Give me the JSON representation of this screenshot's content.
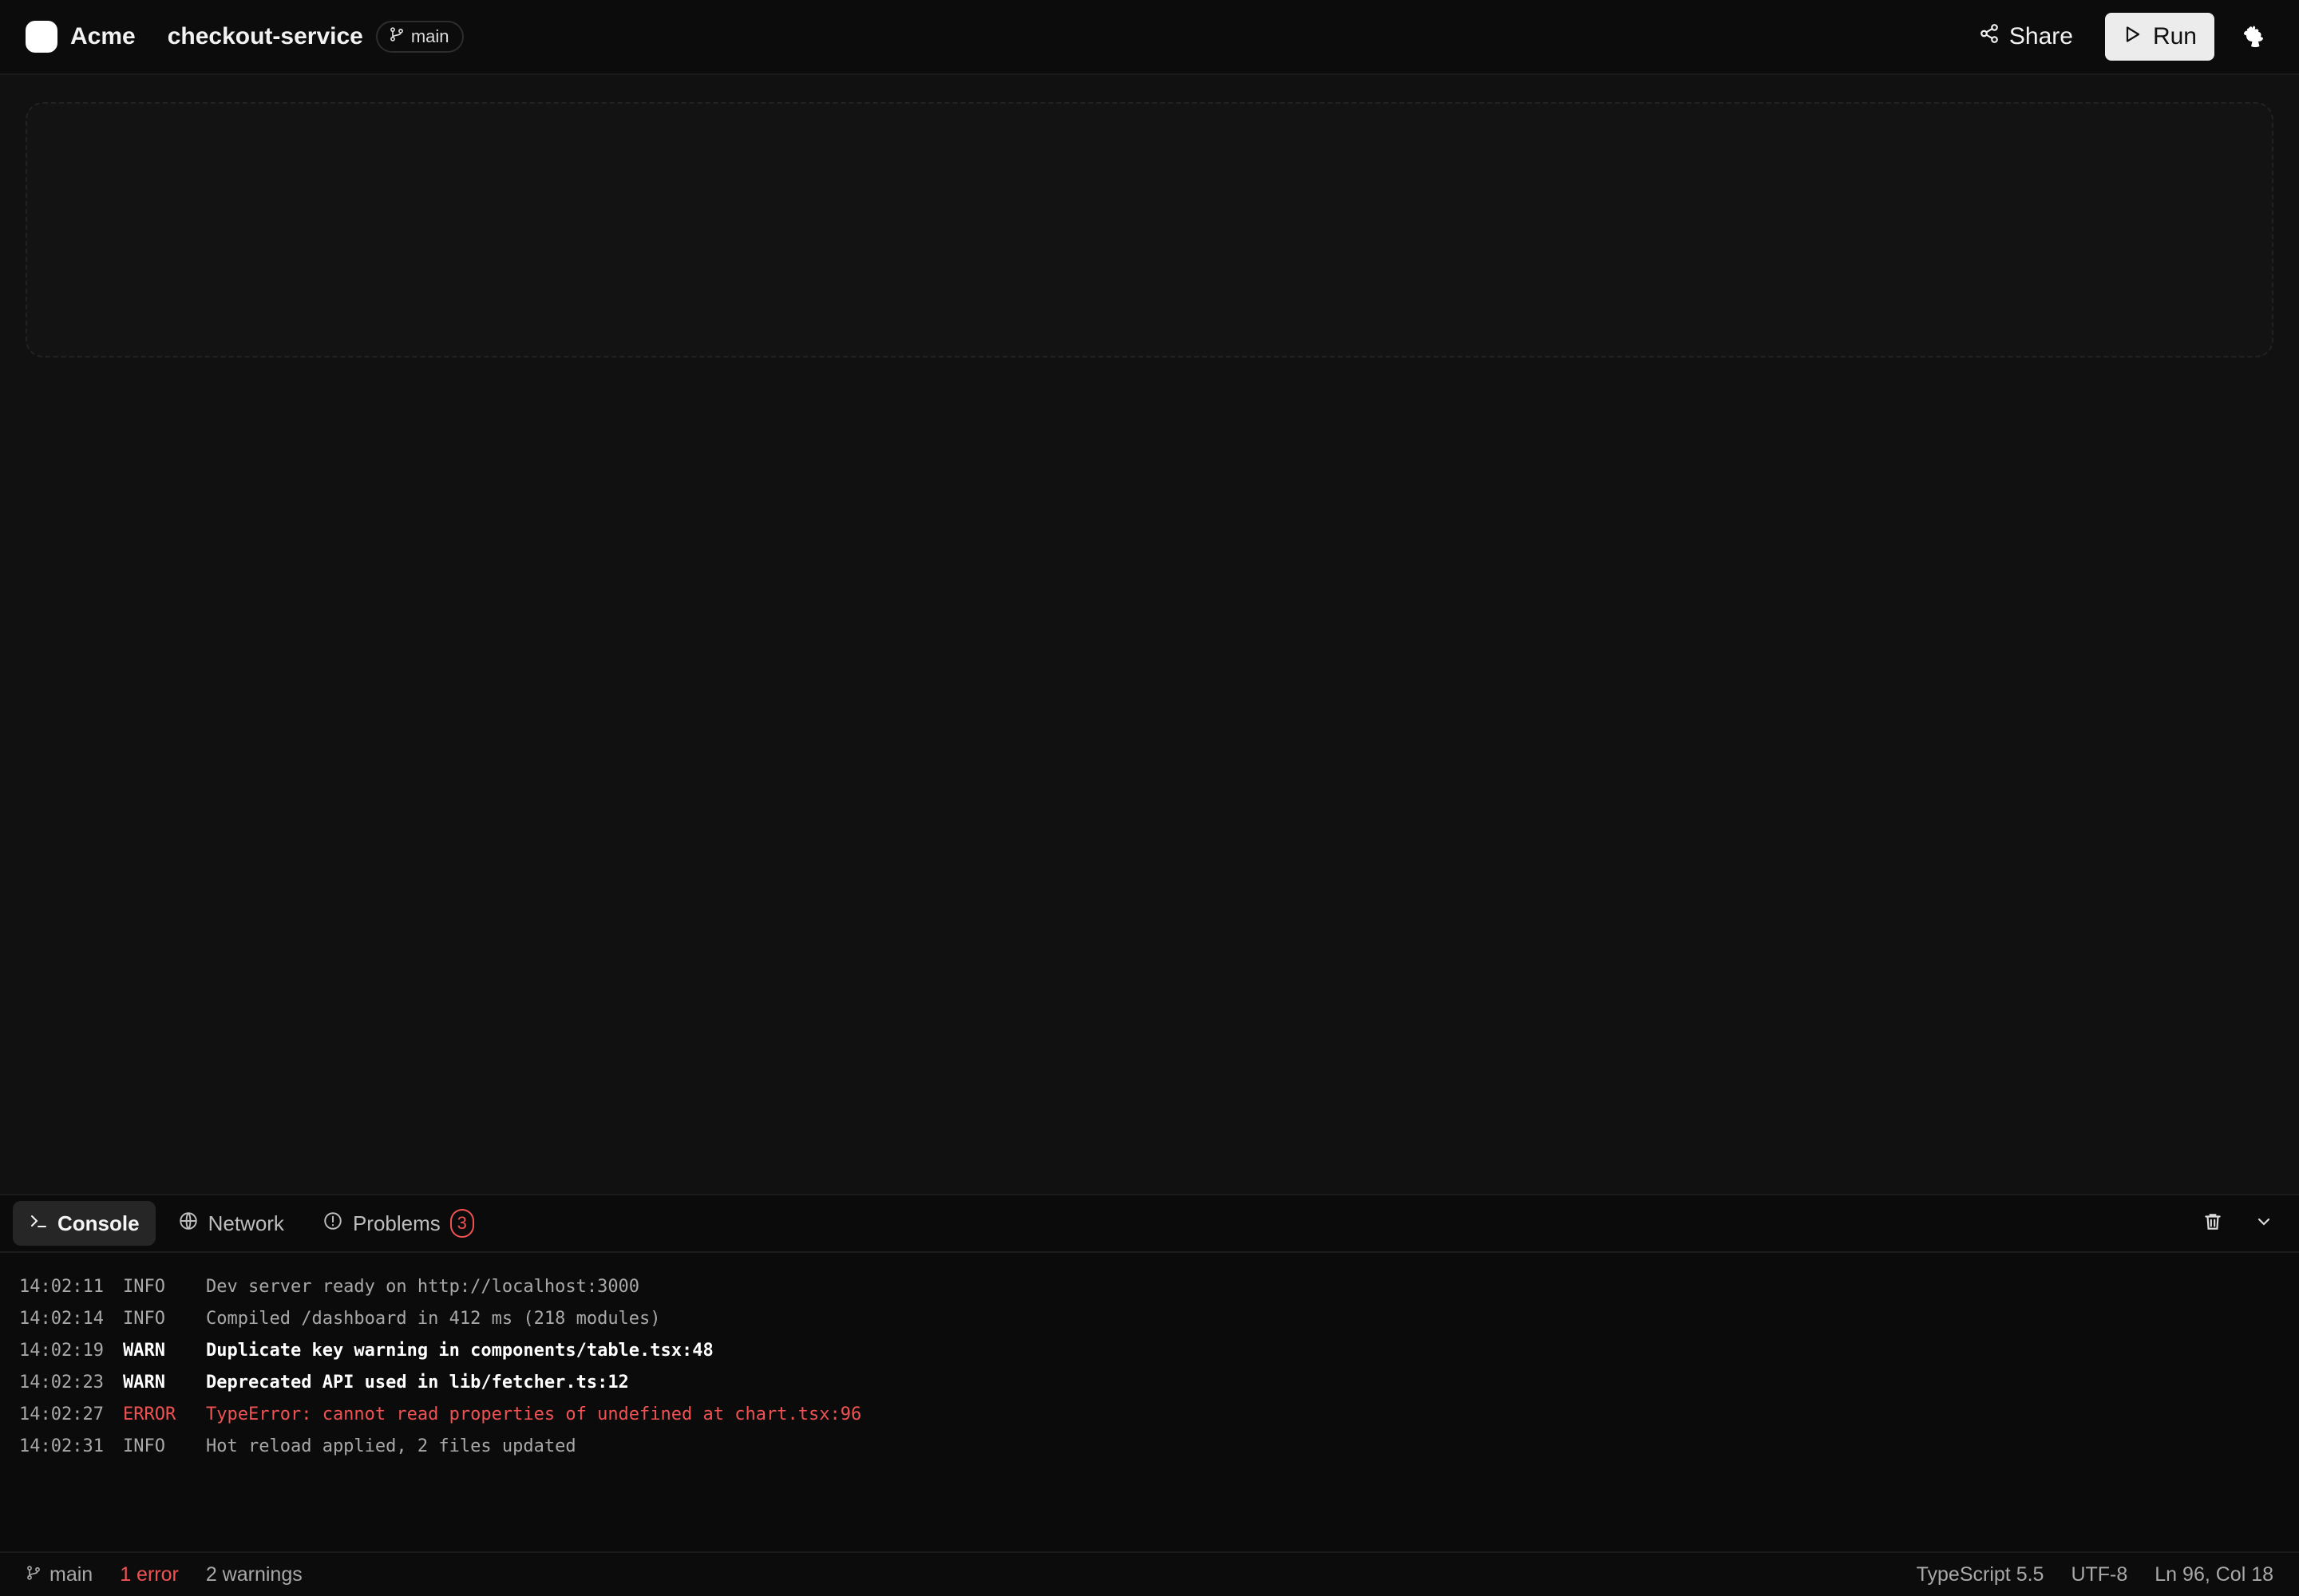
{
  "header": {
    "brand": "Acme",
    "project": "checkout-service",
    "branch": "main",
    "share_label": "Share",
    "run_label": "Run"
  },
  "panel": {
    "tabs": [
      {
        "label": "Console",
        "icon": "terminal-icon"
      },
      {
        "label": "Network",
        "icon": "globe-icon"
      },
      {
        "label": "Problems",
        "icon": "alert-circle-icon",
        "badge": "3"
      }
    ],
    "logs": [
      {
        "time": "14:02:11",
        "level": "INFO",
        "message": "Dev server ready on http://localhost:3000"
      },
      {
        "time": "14:02:14",
        "level": "INFO",
        "message": "Compiled /dashboard in 412 ms (218 modules)"
      },
      {
        "time": "14:02:19",
        "level": "WARN",
        "message": "Duplicate key warning in components/table.tsx:48"
      },
      {
        "time": "14:02:23",
        "level": "WARN",
        "message": "Deprecated API used in lib/fetcher.ts:12"
      },
      {
        "time": "14:02:27",
        "level": "ERROR",
        "message": "TypeError: cannot read properties of undefined at chart.tsx:96"
      },
      {
        "time": "14:02:31",
        "level": "INFO",
        "message": "Hot reload applied, 2 files updated"
      }
    ]
  },
  "statusbar": {
    "branch": "main",
    "errors": "1 error",
    "warnings": "2 warnings",
    "language": "TypeScript 5.5",
    "encoding": "UTF-8",
    "cursor": "Ln 96, Col 18"
  },
  "colors": {
    "background": "#111111",
    "error": "#f05252",
    "run_button": "#ececec"
  }
}
